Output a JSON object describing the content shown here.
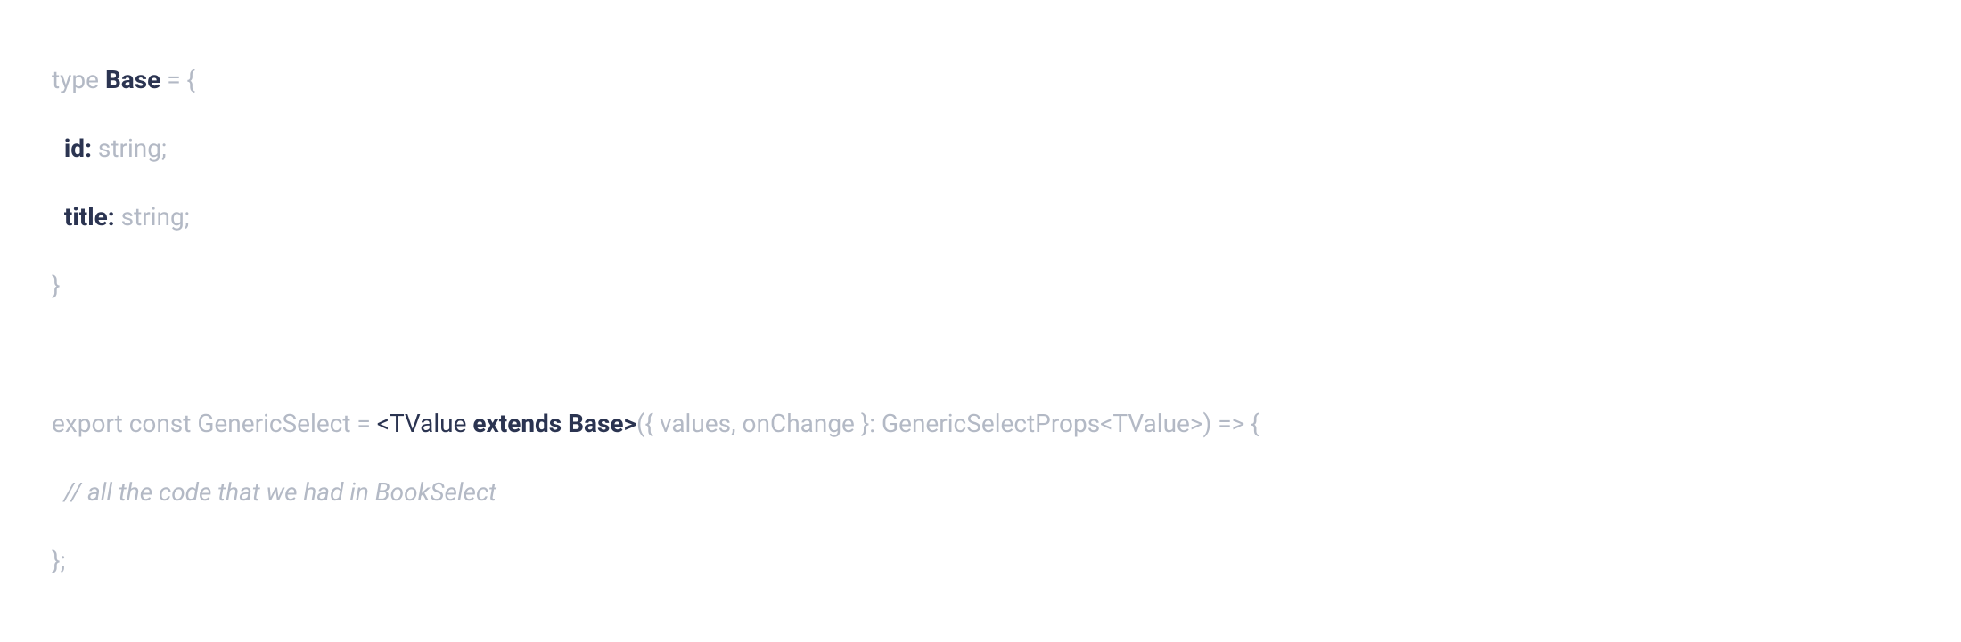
{
  "code": {
    "line1": {
      "t1": "type ",
      "t2": "Base",
      "t3": " = {"
    },
    "line2": {
      "t1": "  ",
      "t2": "id:",
      "t3": " string;"
    },
    "line3": {
      "t1": "  ",
      "t2": "title:",
      "t3": " string;"
    },
    "line4": {
      "t1": "}"
    },
    "line5": {
      "t1": ""
    },
    "line6": {
      "t1": "export const GenericSelect = ",
      "t2": "<TValue ",
      "t3": "extends Base>",
      "t4": "({ values, onChange }: GenericSelectProps<TValue>) => {"
    },
    "line7": {
      "t1": "  // all the code that we had in BookSelect"
    },
    "line8": {
      "t1": "};"
    }
  }
}
